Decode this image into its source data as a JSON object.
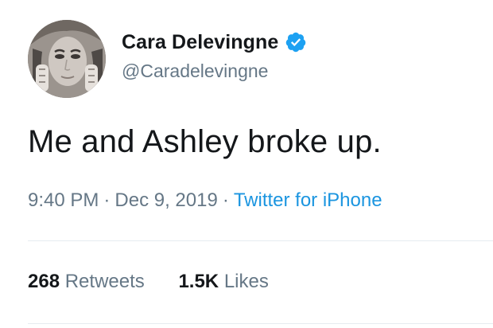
{
  "tweet": {
    "author": {
      "display_name": "Cara Delevingne",
      "handle": "@Caradelevingne",
      "verified": true,
      "avatar_icon": "profile-photo"
    },
    "text": "Me and Ashley broke up.",
    "time": "9:40 PM",
    "date": "Dec 9, 2019",
    "separator": "·",
    "source": "Twitter for iPhone",
    "stats": {
      "retweets_count": "268",
      "retweets_label": "Retweets",
      "likes_count": "1.5K",
      "likes_label": "Likes"
    }
  },
  "colors": {
    "text_primary": "#14171a",
    "text_secondary": "#657786",
    "link": "#1b95e0",
    "verified": "#1da1f2",
    "divider": "#e6ecf0"
  }
}
